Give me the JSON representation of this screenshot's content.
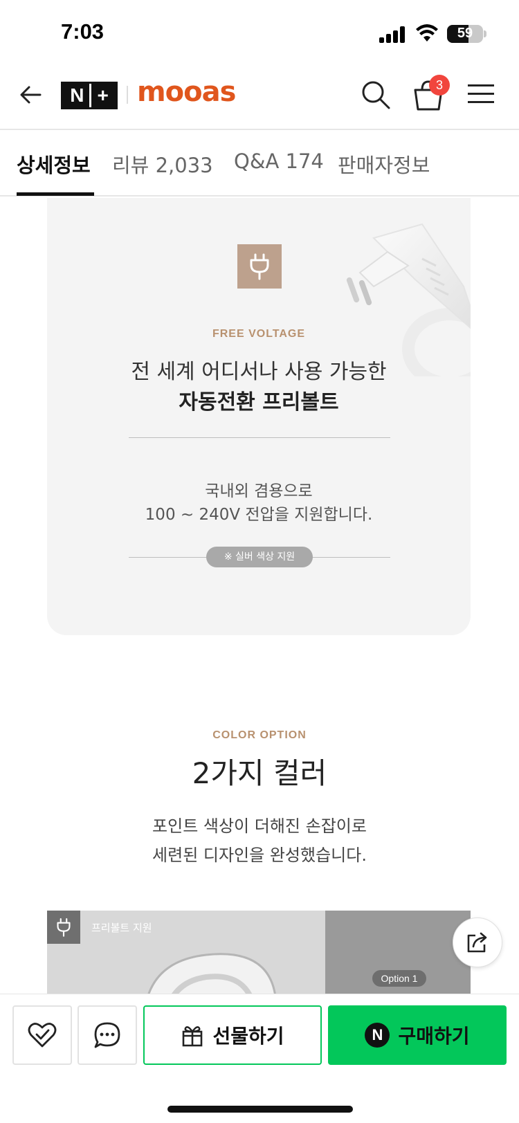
{
  "status_bar": {
    "time": "7:03",
    "battery": "59",
    "battery_level": 0.59
  },
  "header": {
    "nplus_logo_left": "N",
    "nplus_logo_right": "+",
    "brand_logo": "mooas",
    "cart_count": "3"
  },
  "tabs": [
    {
      "label": "상세정보",
      "active": true
    },
    {
      "label": "리뷰 2,033",
      "active": false
    },
    {
      "label": "Q&A 174",
      "active": false
    },
    {
      "label": "판매자정보",
      "active": false
    }
  ],
  "feature_card": {
    "kicker": "FREE VOLTAGE",
    "title_line1": "전 세계 어디서나 사용 가능한",
    "title_line2": "자동전환 프리볼트",
    "desc_line1": "국내외 겸용으로",
    "desc_line2": "100 ~ 240V 전압을 지원합니다.",
    "note_pill": "※ 실버 색상 지원"
  },
  "color_section": {
    "kicker": "COLOR OPTION",
    "title": "2가지 컬러",
    "desc_line1": "포인트 색상이 더해진 손잡이로",
    "desc_line2": "세련된 디자인을 완성했습니다."
  },
  "preview": {
    "label": "프리볼트 지원",
    "option_pill": "Option 1"
  },
  "bottom_bar": {
    "gift_label": "선물하기",
    "buy_badge": "N",
    "buy_label": "구매하기"
  },
  "colors": {
    "accent_green": "#03c75a",
    "brand_orange": "#e0561d",
    "kicker_beige": "#b8916f",
    "badge_red": "#f1453d"
  },
  "icons": [
    "back-arrow-icon",
    "search-icon",
    "cart-icon",
    "menu-icon",
    "plug-icon",
    "share-icon",
    "heart-check-icon",
    "chat-icon",
    "gift-icon"
  ]
}
